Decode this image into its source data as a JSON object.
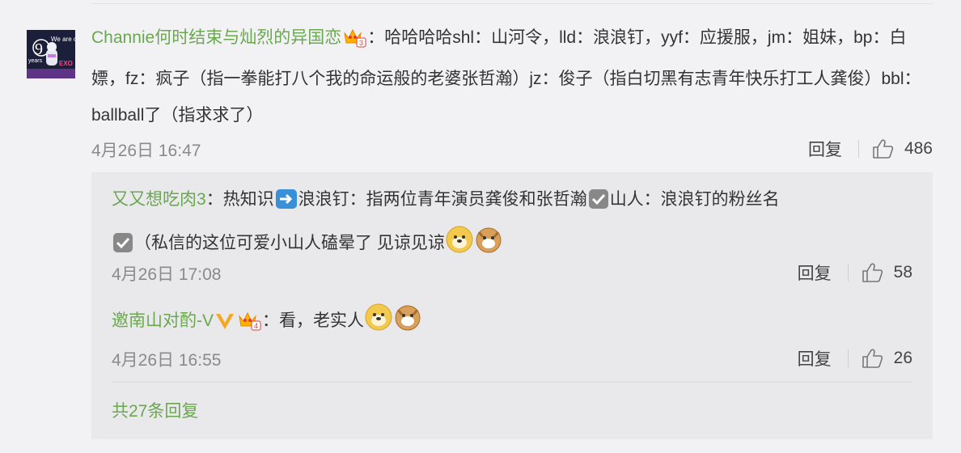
{
  "main": {
    "username": "Channie何时结束与灿烈的异国恋",
    "avatar_text": "We are one",
    "avatar_num": "9",
    "avatar_sub": "years",
    "avatar_exo": "EXO",
    "badge_level": "3",
    "text": "：哈哈哈哈shl：山河令，lld：浪浪钉，yyf：应援服，jm：姐妹，bp：白嫖，fz：疯子（指一拳能打八个我的命运般的老婆张哲瀚）jz：俊子（指白切黑有志青年快乐打工人龚俊）bbl：ballball了（指求求了）",
    "time": "4月26日 16:47",
    "reply_label": "回复",
    "likes": "486"
  },
  "replies": [
    {
      "username": "又又想吃肉3",
      "text_a": "：热知识",
      "text_b": "浪浪钉：指两位青年演员龚俊和张哲瀚",
      "text_c": "山人：浪浪钉的粉丝名",
      "text_d": "（私信的这位可爱小山人磕晕了 见谅见谅",
      "time": "4月26日 17:08",
      "reply_label": "回复",
      "likes": "58"
    },
    {
      "username": "邀南山对酌-V",
      "badge_level": "4",
      "text": "：看，老实人",
      "time": "4月26日 16:55",
      "reply_label": "回复",
      "likes": "26"
    }
  ],
  "more_replies": "共27条回复",
  "colors": {
    "link": "#6aa84f",
    "bg": "#f2f2f5",
    "sub_bg": "#e9e9ec"
  }
}
